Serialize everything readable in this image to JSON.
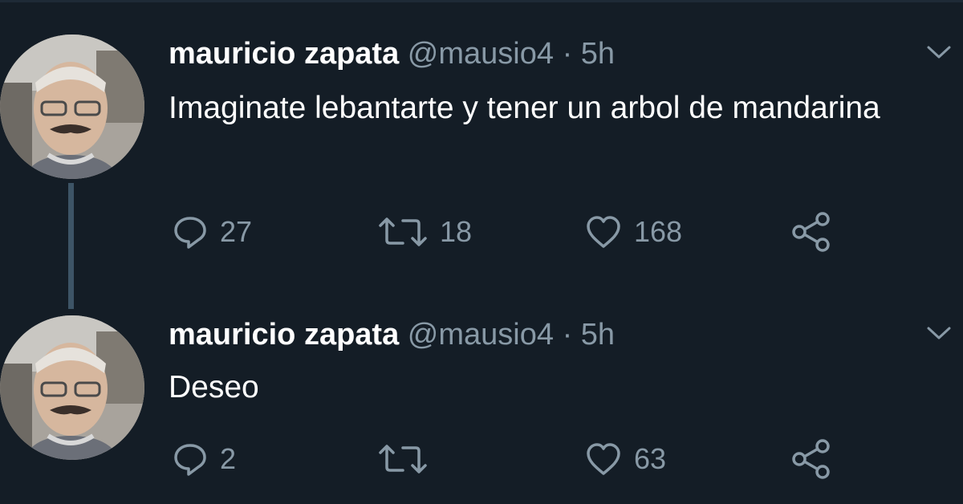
{
  "colors": {
    "background": "#141d26",
    "primary_text": "#ffffff",
    "secondary_text": "#8899a6",
    "thread_line": "#3d5466"
  },
  "tweets": [
    {
      "author": {
        "name": "mauricio zapata",
        "handle": "@mausio4",
        "separator": "·",
        "time": "5h"
      },
      "text": "Imaginate lebantarte y tener un arbol de mandarina",
      "actions": {
        "reply_icon": "reply-icon",
        "reply_count": "27",
        "retweet_icon": "retweet-icon",
        "retweet_count": "18",
        "like_icon": "like-icon",
        "like_count": "168",
        "share_icon": "share-icon"
      }
    },
    {
      "author": {
        "name": "mauricio zapata",
        "handle": "@mausio4",
        "separator": "·",
        "time": "5h"
      },
      "text": "Deseo",
      "actions": {
        "reply_icon": "reply-icon",
        "reply_count": "2",
        "retweet_icon": "retweet-icon",
        "retweet_count": "",
        "like_icon": "like-icon",
        "like_count": "63",
        "share_icon": "share-icon"
      }
    }
  ]
}
